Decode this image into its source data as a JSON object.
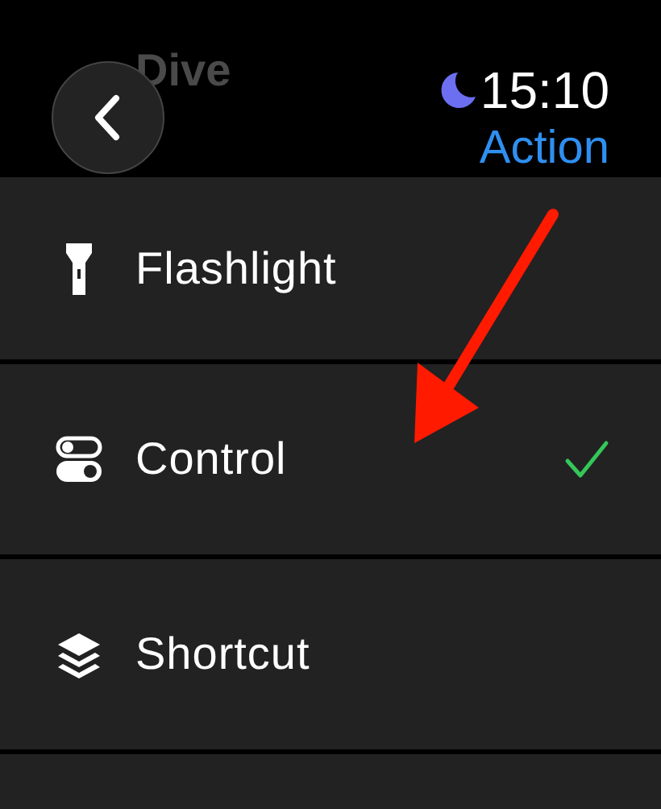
{
  "background_title": "Dive",
  "status": {
    "time": "15:10",
    "do_not_disturb": true
  },
  "title": "Action",
  "items": [
    {
      "label": "Flashlight",
      "selected": false
    },
    {
      "label": "Control",
      "selected": true
    },
    {
      "label": "Shortcut",
      "selected": false
    }
  ]
}
